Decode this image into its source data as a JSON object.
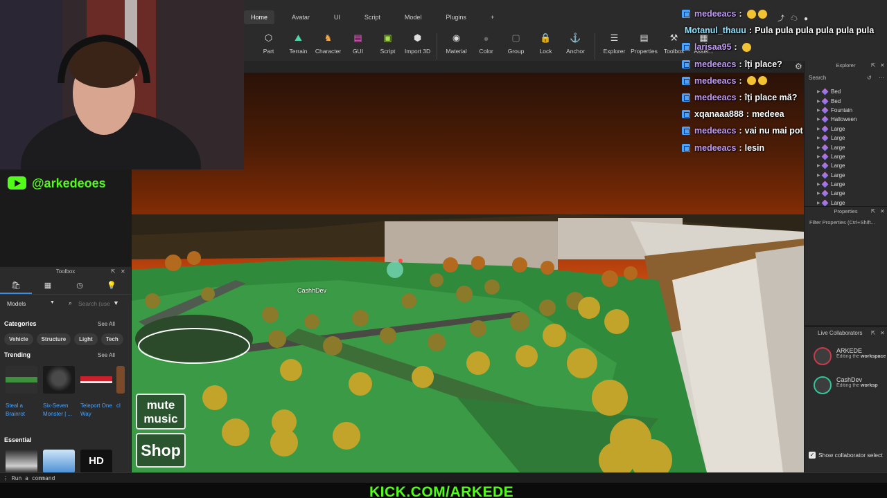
{
  "ribbon": {
    "tabs": [
      "Home",
      "Avatar",
      "UI",
      "Script",
      "Model",
      "Plugins",
      "+"
    ],
    "tools": [
      {
        "label": "Part",
        "icon": "part-cube-icon"
      },
      {
        "label": "Terrain",
        "icon": "terrain-icon"
      },
      {
        "label": "Character",
        "icon": "character-icon"
      },
      {
        "label": "GUI",
        "icon": "gui-icon"
      },
      {
        "label": "Script",
        "icon": "script-icon"
      },
      {
        "label": "Import 3D",
        "icon": "import-3d-icon"
      },
      {
        "label": "Material",
        "icon": "material-icon"
      },
      {
        "label": "Color",
        "icon": "color-icon"
      },
      {
        "label": "Group",
        "icon": "group-icon"
      },
      {
        "label": "Lock",
        "icon": "lock-icon"
      },
      {
        "label": "Anchor",
        "icon": "anchor-icon"
      },
      {
        "label": "Explorer",
        "icon": "explorer-icon"
      },
      {
        "label": "Properties",
        "icon": "properties-icon"
      },
      {
        "label": "Toolbox",
        "icon": "toolbox-icon"
      },
      {
        "label": "Asset...",
        "icon": "asset-manager-icon"
      }
    ]
  },
  "channel": {
    "handle": "@arkedeoes"
  },
  "toolbox": {
    "title": "Toolbox",
    "category_select": "Models",
    "search_placeholder": "Search (use",
    "categories_label": "Categories",
    "see_all": "See All",
    "chips": [
      "Vehicle",
      "Structure",
      "Light",
      "Tech"
    ],
    "trending_label": "Trending",
    "trending": [
      {
        "name": "Steal a Brainrot"
      },
      {
        "name": "Six-Seven Monster | ..."
      },
      {
        "name": "Teleport One Way"
      },
      {
        "name": "cl"
      }
    ],
    "essential_label": "Essential",
    "hd_label": "HD"
  },
  "explorer": {
    "title": "Explorer",
    "search_placeholder": "Search",
    "items": [
      "Bed",
      "Bed",
      "Fountain",
      "Halloween",
      "Large",
      "Large",
      "Large",
      "Large",
      "Large",
      "Large",
      "Large",
      "Large",
      "Large"
    ]
  },
  "properties": {
    "title": "Properties",
    "filter_placeholder": "Filter Properties (Ctrl+Shift..."
  },
  "collaborators": {
    "title": "Live Collaborators",
    "users": [
      {
        "name": "ARKEDE",
        "status": "Editing the ",
        "target": "workspace"
      },
      {
        "name": "CashDev",
        "status": "Editing the ",
        "target": "worksp"
      }
    ],
    "show_label": "Show collaborator select"
  },
  "game": {
    "player_tag": "CashhDev",
    "mute_label": "mute music",
    "shop_label": "Shop"
  },
  "chat": [
    {
      "user": "medeeacs",
      "text": "",
      "emojis": 2
    },
    {
      "user": "Motanul_thauu",
      "text": "Pula pula pula pula pula pula",
      "emojis": 0,
      "nobadge": true
    },
    {
      "user": "larisaa95",
      "text": "",
      "emojis": 1
    },
    {
      "user": "medeeacs",
      "text": "îți place?",
      "emojis": 0
    },
    {
      "user": "medeeacs",
      "text": "",
      "emojis": 2
    },
    {
      "user": "medeeacs",
      "text": "îți place mă?",
      "emojis": 0
    },
    {
      "user": "xqanaaa888",
      "text": "medeea",
      "emojis": 0,
      "white": true
    },
    {
      "user": "medeeacs",
      "text": "vai nu mai pot",
      "emojis": 0
    },
    {
      "user": "medeeacs",
      "text": "lesin",
      "emojis": 0
    }
  ],
  "command_bar": {
    "placeholder": "Run a command"
  },
  "footer": {
    "url": "KICK.COM/ARKEDE"
  },
  "colors": {
    "kick_green": "#53fc18",
    "chat_username": "#c39af5",
    "accent_blue": "#3a8ee8"
  }
}
